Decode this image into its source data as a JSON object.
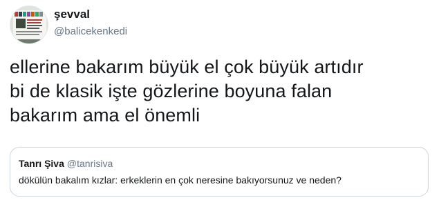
{
  "author": {
    "display_name": "şevval",
    "handle": "@balicekenkedi"
  },
  "tweet": {
    "lines": [
      "ellerine bakarım büyük el çok büyük artıdır",
      "bi de klasik işte gözlerine boyuna falan",
      "bakarım ama el önemli"
    ]
  },
  "quoted_tweet": {
    "display_name": "Tanrı Şiva",
    "handle": "@tanrisiva",
    "text": "dökülün bakalım kızlar: erkeklerin en çok neresine bakıyorsunuz ve neden?"
  },
  "colors": {
    "text_primary": "#14171a",
    "text_secondary": "#657786",
    "border": "#ccd6dd"
  },
  "icons": {
    "avatar": "profile-picture"
  }
}
